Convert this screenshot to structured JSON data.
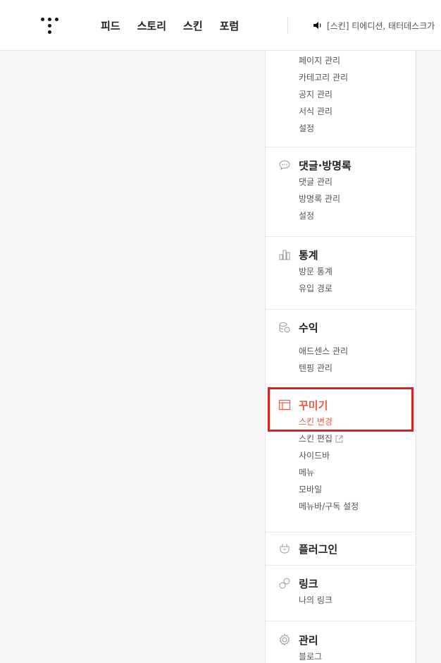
{
  "header": {
    "nav": [
      "피드",
      "스토리",
      "스킨",
      "포럼"
    ],
    "notice": "[스킨] 티에디션, 태터데스크가"
  },
  "sidebar": {
    "top_items": [
      "페이지 관리",
      "카테고리 관리",
      "공지 관리",
      "서식 관리",
      "설정"
    ],
    "comments": {
      "title": "댓글·방명록",
      "items": [
        "댓글 관리",
        "방명록 관리",
        "설정"
      ]
    },
    "stats": {
      "title": "통계",
      "items": [
        "방문 통계",
        "유입 경로"
      ]
    },
    "revenue": {
      "title": "수익",
      "items": [
        "애드센스 관리",
        "텐핑 관리"
      ]
    },
    "decorate": {
      "title": "꾸미기",
      "items": [
        "스킨 변경",
        "스킨 편집",
        "사이드바",
        "메뉴",
        "모바일",
        "메뉴바/구독 설정"
      ]
    },
    "plugin": {
      "title": "플러그인"
    },
    "link": {
      "title": "링크",
      "items": [
        "나의 링크"
      ]
    },
    "manage": {
      "title": "관리",
      "items": [
        "블로그"
      ]
    }
  },
  "colors": {
    "active": "#ef5a42",
    "highlight_border": "#e0201f"
  }
}
